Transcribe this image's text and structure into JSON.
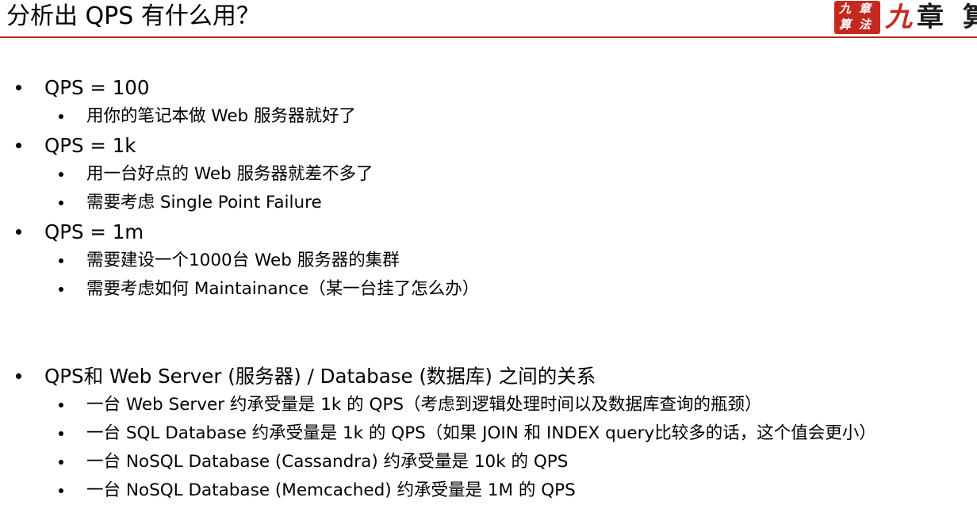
{
  "header": {
    "title": "分析出 QPS 有什么用？",
    "logo": {
      "seal_chars": [
        "九",
        "章",
        "算",
        "法"
      ],
      "text_red": "九",
      "text_dark": "章 算"
    },
    "accent_color": "#b5261e"
  },
  "sections": [
    {
      "bullet": "QPS = 100",
      "sub": [
        "用你的笔记本做 Web 服务器就好了"
      ]
    },
    {
      "bullet": "QPS = 1k",
      "sub": [
        "用一台好点的 Web 服务器就差不多了",
        "需要考虑 Single Point Failure"
      ]
    },
    {
      "bullet": "QPS = 1m",
      "sub": [
        "需要建设一个1000台 Web 服务器的集群",
        "需要考虑如何 Maintainance（某一台挂了怎么办）"
      ]
    },
    {
      "bullet": "QPS和 Web Server (服务器) / Database (数据库) 之间的关系",
      "sub": [
        "一台 Web Server 约承受量是 1k 的 QPS（考虑到逻辑处理时间以及数据库查询的瓶颈）",
        "一台 SQL Database 约承受量是 1k 的 QPS（如果 JOIN 和 INDEX query比较多的话，这个值会更小）",
        "一台 NoSQL Database (Cassandra) 约承受量是 10k 的 QPS",
        "一台 NoSQL Database (Memcached) 约承受量是 1M 的 QPS"
      ]
    }
  ]
}
